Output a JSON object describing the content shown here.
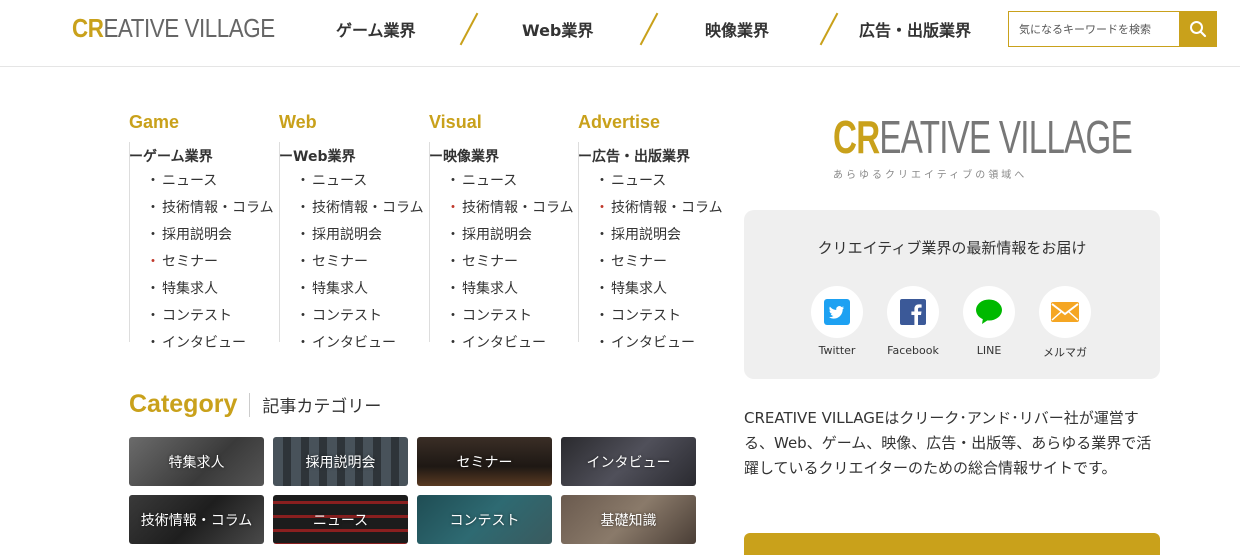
{
  "header": {
    "logo_cr": "CR",
    "logo_rest": "EATIVE VILLAGE",
    "nav": [
      "ゲーム業界",
      "Web業界",
      "映像業界",
      "広告・出版業界"
    ],
    "search_placeholder": "気になるキーワードを検索"
  },
  "columns": [
    {
      "title": "Game",
      "head": "ーゲーム業界",
      "items": [
        "ニュース",
        "技術情報・コラム",
        "採用説明会",
        "セミナー",
        "特集求人",
        "コンテスト",
        "インタビュー"
      ]
    },
    {
      "title": "Web",
      "head": "ーWeb業界",
      "items": [
        "ニュース",
        "技術情報・コラム",
        "採用説明会",
        "セミナー",
        "特集求人",
        "コンテスト",
        "インタビュー"
      ]
    },
    {
      "title": "Visual",
      "head": "ー映像業界",
      "items": [
        "ニュース",
        "技術情報・コラム",
        "採用説明会",
        "セミナー",
        "特集求人",
        "コンテスト",
        "インタビュー"
      ]
    },
    {
      "title": "Advertise",
      "head": "ー広告・出版業界",
      "items": [
        "ニュース",
        "技術情報・コラム",
        "採用説明会",
        "セミナー",
        "特集求人",
        "コンテスト",
        "インタビュー"
      ]
    }
  ],
  "category": {
    "title": "Category",
    "subtitle": "記事カテゴリー",
    "tiles": [
      "特集求人",
      "採用説明会",
      "セミナー",
      "インタビュー",
      "技術情報・コラム",
      "ニュース",
      "コンテスト",
      "基礎知識"
    ]
  },
  "right": {
    "logo_cr": "CR",
    "logo_rest": "EATIVE VILLAGE",
    "tagline": "あらゆるクリエイティブの領域へ",
    "sns_title": "クリエイティブ業界の最新情報をお届け",
    "sns": [
      "Twitter",
      "Facebook",
      "LINE",
      "メルマガ"
    ],
    "description": "CREATIVE VILLAGEはクリーク･アンド･リバー社が運営する、Web、ゲーム、映像、広告・出版等、あらゆる業界で活躍しているクリエイターのための総合情報サイトです。"
  },
  "colors": {
    "accent": "#c9a11b",
    "panel": "#efefef"
  }
}
